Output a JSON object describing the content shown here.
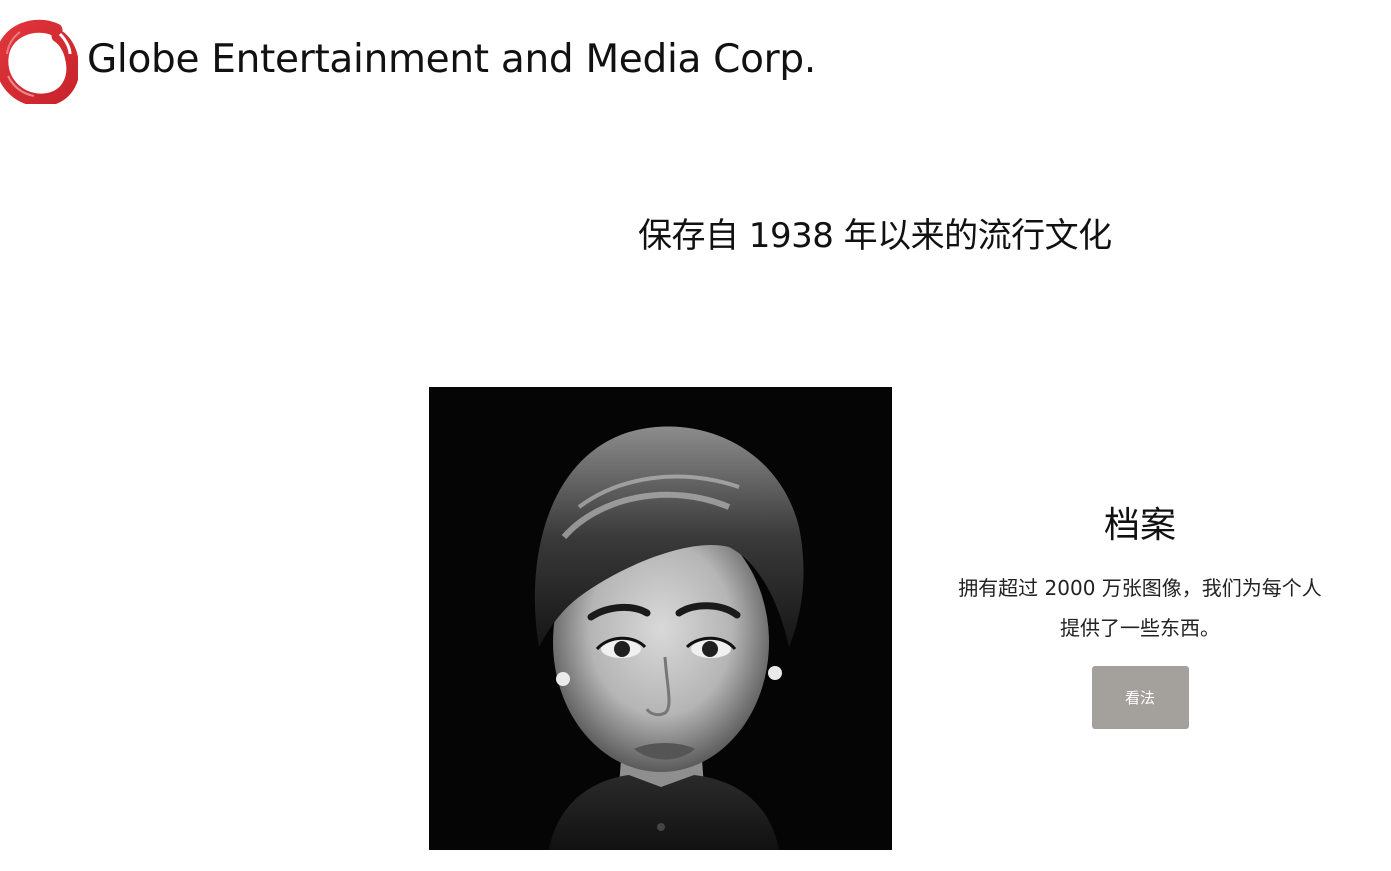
{
  "header": {
    "logo_icon": "globe-brush-circle-logo",
    "brand_name": "Globe Entertainment and Media Corp."
  },
  "hero": {
    "tagline": "保存自 1938 年以来的流行文化"
  },
  "archive": {
    "image_subject": "black-and-white portrait photo",
    "title": "档案",
    "description": "拥有超过 2000 万张图像，我们为每个人提供了一些东西。",
    "button_label": "看法"
  },
  "colors": {
    "logo_red": "#d52b32",
    "button_bg": "#a4a19c",
    "button_text": "#ffffff",
    "text": "#111111",
    "image_bg": "#050505"
  }
}
